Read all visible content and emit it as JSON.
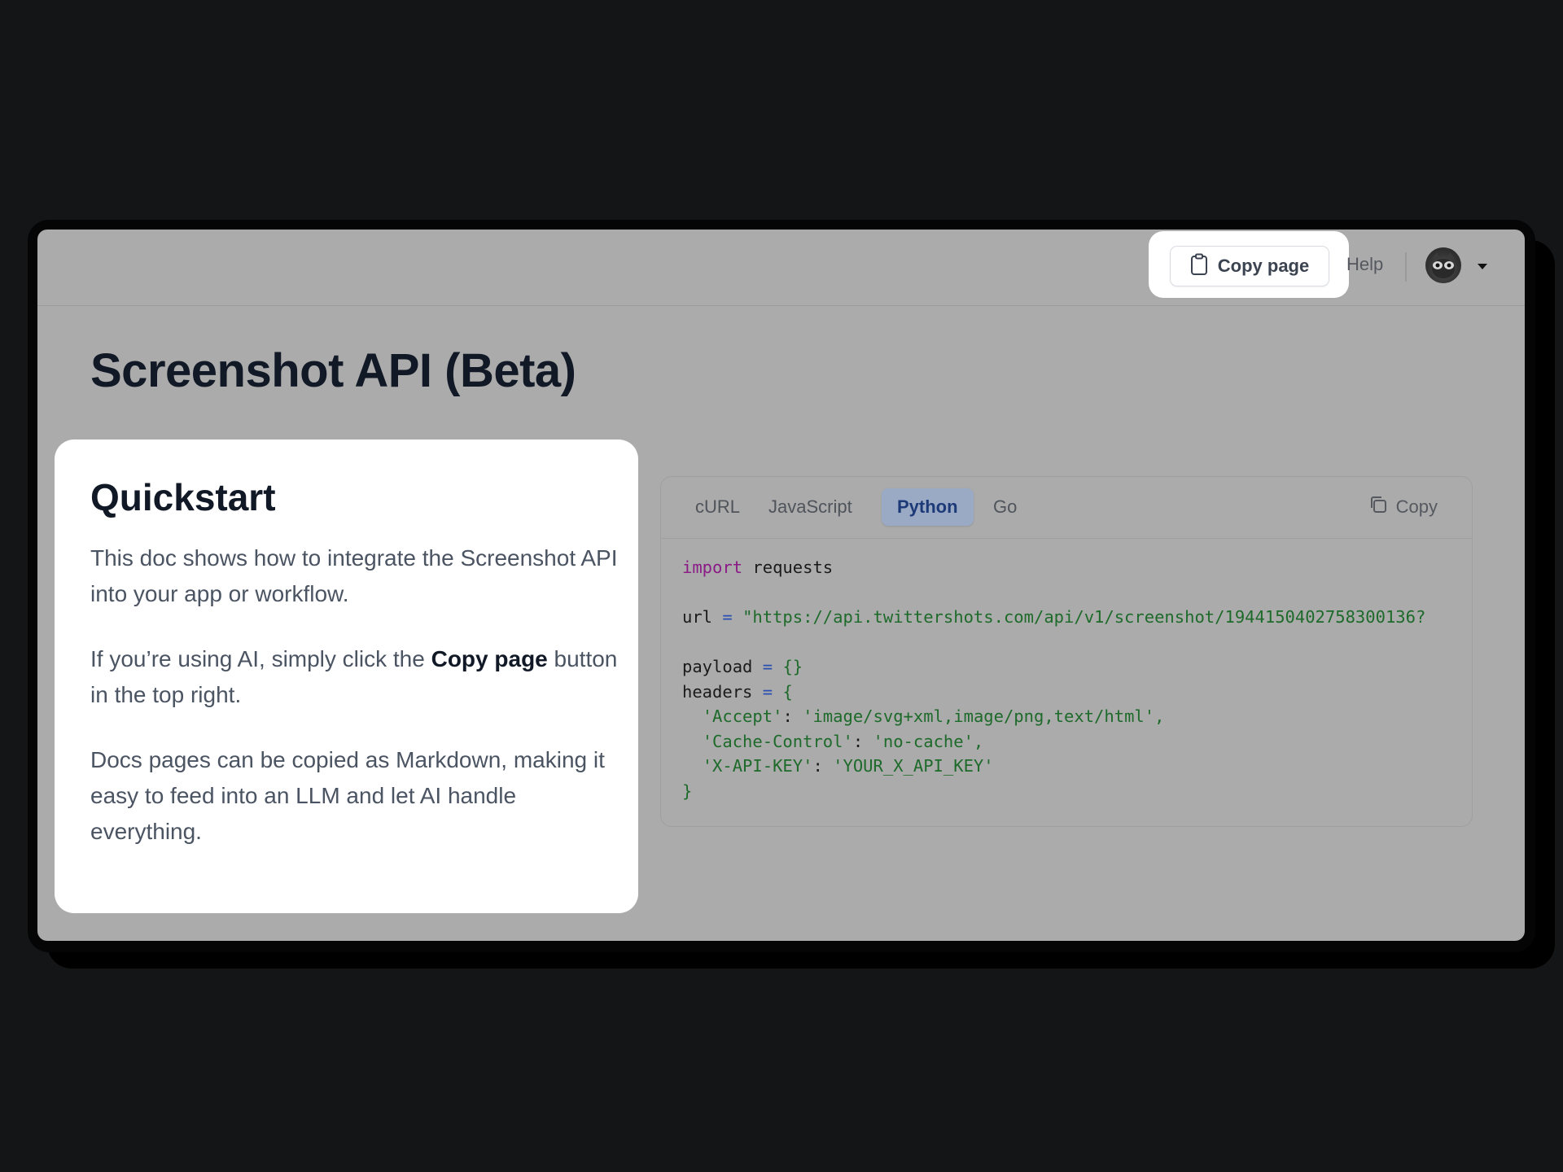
{
  "topbar": {
    "copy_page_label": "Copy page",
    "help_label": "Help"
  },
  "page": {
    "title": "Screenshot API (Beta)"
  },
  "quickstart": {
    "title": "Quickstart",
    "para1": "This doc shows how to integrate the Screenshot API into your app or workflow.",
    "para2_pre": "If you’re using AI, simply click the ",
    "para2_bold": "Copy page",
    "para2_post": " button in the top right.",
    "para3": "Docs pages can be copied as Markdown, making it easy to feed into an LLM and let AI handle everything."
  },
  "code_panel": {
    "tabs": [
      {
        "label": "cURL",
        "active": false
      },
      {
        "label": "JavaScript",
        "active": false
      },
      {
        "label": "Python",
        "active": true
      },
      {
        "label": "Go",
        "active": false
      }
    ],
    "copy_label": "Copy",
    "code": {
      "import_kw": "import",
      "import_mod": " requests",
      "url_var": "url",
      "url_value": "\"https://api.twittershots.com/api/v1/screenshot/1944150402758300136?",
      "payload_var": "payload",
      "payload_value": "{}",
      "headers_var": "headers",
      "headers_open": "{",
      "header_accept_key": "'Accept'",
      "header_accept_val": "'image/svg+xml,image/png,text/html',",
      "header_cache_key": "'Cache-Control'",
      "header_cache_val": "'no-cache',",
      "header_apikey_key": "'X-API-KEY'",
      "header_apikey_val": "'YOUR_X_API_KEY'",
      "headers_close": "}"
    }
  },
  "colors": {
    "background": "#141517",
    "window_dim": "#ababab",
    "active_tab": "#9aa9c4",
    "keyword": "#8a1a86",
    "string": "#1d6a2a"
  },
  "icons": {
    "copy_page": "clipboard-icon",
    "copy_code": "copy-icon",
    "avatar": "user-avatar",
    "menu": "caret-down-icon"
  }
}
